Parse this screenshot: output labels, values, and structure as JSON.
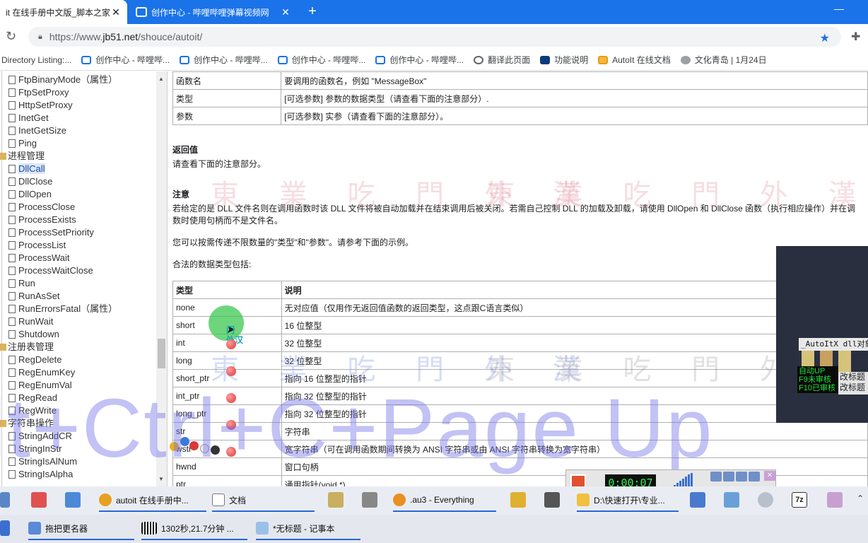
{
  "browser": {
    "tabs": [
      {
        "title": "it 在线手册中文版_脚本之家",
        "active": true
      },
      {
        "title": "创作中心 - 哔哩哔哩弹幕视频网",
        "active": false
      }
    ],
    "url_prefix": "https://www.",
    "url_domain": "jb51.net",
    "url_path": "/shouce/autoit/",
    "bookmarks": [
      "Directory Listing:...",
      "创作中心 - 哔哩哔...",
      "创作中心 - 哔哩哔...",
      "创作中心 - 哔哩哔...",
      "创作中心 - 哔哩哔...",
      "翻译此页面",
      "功能说明",
      "AutoIt 在线文档",
      "文化青岛 | 1月24日"
    ]
  },
  "tree": [
    {
      "label": "FtpBinaryMode（属性）",
      "type": "leaf"
    },
    {
      "label": "FtpSetProxy",
      "type": "leaf"
    },
    {
      "label": "HttpSetProxy",
      "type": "leaf"
    },
    {
      "label": "InetGet",
      "type": "leaf"
    },
    {
      "label": "InetGetSize",
      "type": "leaf"
    },
    {
      "label": "Ping",
      "type": "leaf"
    },
    {
      "label": "进程管理",
      "type": "folder"
    },
    {
      "label": "DllCall",
      "type": "leaf",
      "selected": true
    },
    {
      "label": "DllClose",
      "type": "leaf"
    },
    {
      "label": "DllOpen",
      "type": "leaf"
    },
    {
      "label": "ProcessClose",
      "type": "leaf"
    },
    {
      "label": "ProcessExists",
      "type": "leaf"
    },
    {
      "label": "ProcessSetPriority",
      "type": "leaf"
    },
    {
      "label": "ProcessList",
      "type": "leaf"
    },
    {
      "label": "ProcessWait",
      "type": "leaf"
    },
    {
      "label": "ProcessWaitClose",
      "type": "leaf"
    },
    {
      "label": "Run",
      "type": "leaf"
    },
    {
      "label": "RunAsSet",
      "type": "leaf"
    },
    {
      "label": "RunErrorsFatal（属性）",
      "type": "leaf"
    },
    {
      "label": "RunWait",
      "type": "leaf"
    },
    {
      "label": "Shutdown",
      "type": "leaf"
    },
    {
      "label": "注册表管理",
      "type": "folder"
    },
    {
      "label": "RegDelete",
      "type": "leaf"
    },
    {
      "label": "RegEnumKey",
      "type": "leaf"
    },
    {
      "label": "RegEnumVal",
      "type": "leaf"
    },
    {
      "label": "RegRead",
      "type": "leaf"
    },
    {
      "label": "RegWrite",
      "type": "leaf"
    },
    {
      "label": "字符串操作",
      "type": "folder"
    },
    {
      "label": "StringAddCR",
      "type": "leaf"
    },
    {
      "label": "StringInStr",
      "type": "leaf"
    },
    {
      "label": "StringIsAlNum",
      "type": "leaf"
    },
    {
      "label": "StringIsAlpha",
      "type": "leaf"
    }
  ],
  "content": {
    "param_rows": [
      {
        "k": "函数名",
        "v": "要调用的函数名，例如 \"MessageBox\""
      },
      {
        "k": "类型",
        "v": "[可选参数] 参数的数据类型（请查看下面的注意部分）."
      },
      {
        "k": "参数",
        "v": "[可选参数] 实参（请查看下面的注意部分）。"
      }
    ],
    "return_heading": "返回值",
    "return_text": "请查看下面的注意部分。",
    "note_heading": "注意",
    "note_line1": "若给定的是 DLL 文件名则在调用函数时该 DLL 文件将被自动加载并在结束调用后被关闭。若需自己控制 DLL 的加载及卸载，请使用 DllOpen 和 DllClose 函数（执行相应操作）并在调",
    "note_line2": "数时使用句柄而不是文件名。",
    "note_para2": "您可以按需传递不限数量的\"类型\"和\"参数\"。请参考下面的示例。",
    "note_para3": "合法的数据类型包括:",
    "types_header": {
      "k": "类型",
      "v": "说明"
    },
    "type_rows": [
      {
        "k": "none",
        "v": "无对应值（仅用作无返回值函数的返回类型，这点跟C语言类似）"
      },
      {
        "k": "short",
        "v": "16 位整型"
      },
      {
        "k": "int",
        "v": "32 位整型"
      },
      {
        "k": "long",
        "v": "32 位整型"
      },
      {
        "k": "short_ptr",
        "v": "指向 16 位整型的指针"
      },
      {
        "k": "int_ptr",
        "v": "指向 32 位整型的指针"
      },
      {
        "k": "long_ptr",
        "v": "指向 32 位整型的指针"
      },
      {
        "k": "str",
        "v": "字符串"
      },
      {
        "k": "wstr",
        "v": "宽字符串（可在调用函数期间转换为 ANSI 字符串或由 ANSI 字符串转换为宽字符串）"
      },
      {
        "k": "hwnd",
        "v": "窗口句柄"
      },
      {
        "k": "ptr",
        "v": "通用指针(void *)"
      }
    ]
  },
  "overlays": {
    "watermark": "東 業 吃 門 外 漢",
    "key_hint": "lt+Ctrl+C+Page Up",
    "menjian": "门\n外汉",
    "autoit_label": "_AutoItX dll对象",
    "status_lines": [
      "自动UP",
      "F9未审核",
      "F10已审核"
    ],
    "panel_buttons": [
      "改标题",
      "改标题"
    ],
    "recorder_time": "0:00:07"
  },
  "taskbar1": [
    {
      "label": "autoit 在线手册中...",
      "open": true
    },
    {
      "label": "文档",
      "open": true
    },
    {
      "label": ".au3 - Everything",
      "open": true
    },
    {
      "label": "D:\\快速打开\\专业...",
      "open": true
    }
  ],
  "taskbar2": [
    {
      "label": "拖把更名器",
      "open": true
    },
    {
      "label": "1302秒,21.7分钟 ...",
      "open": true
    },
    {
      "label": "*无标题 - 记事本",
      "open": true
    }
  ],
  "taskbar_badge": "7z"
}
